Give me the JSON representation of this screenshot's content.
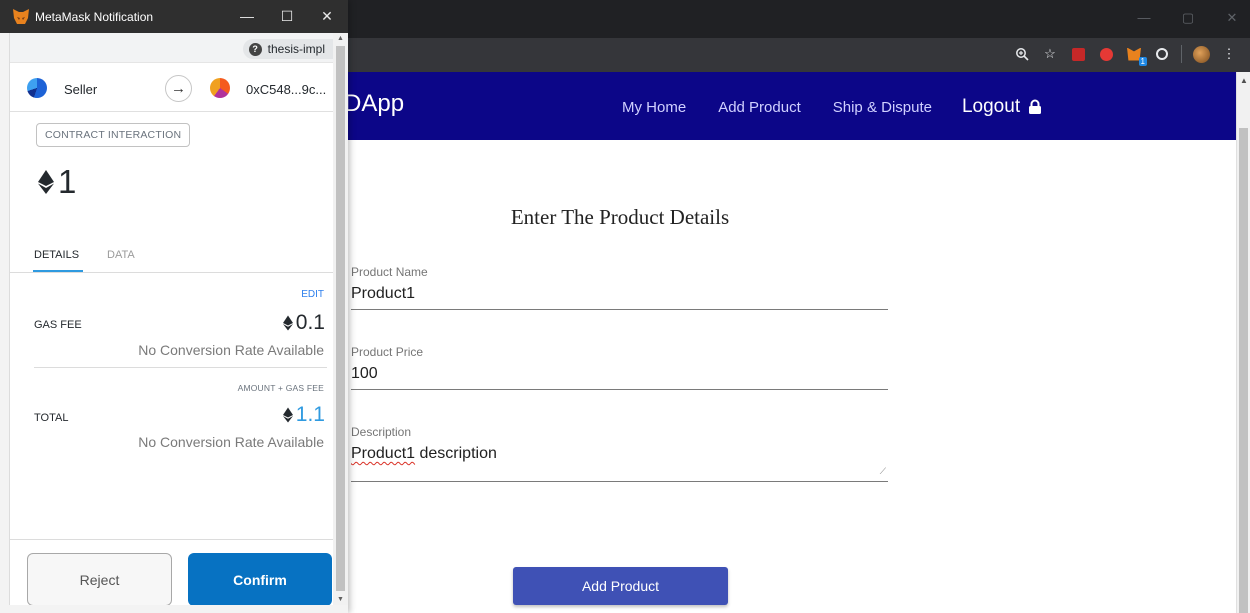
{
  "browser": {
    "window_controls": [
      "—",
      "▢",
      "✕"
    ],
    "toolbar_icons": [
      "zoom-icon",
      "bookmark-star-icon",
      "pdf-extension-icon",
      "adblock-extension-icon",
      "metamask-extension-icon",
      "extension-icon",
      "profile-avatar",
      "menu-icon"
    ],
    "metamask_badge": "1"
  },
  "page": {
    "brand": "DApp",
    "nav": {
      "home": "My Home",
      "add_product": "Add Product",
      "ship_dispute": "Ship & Dispute",
      "logout": "Logout"
    },
    "nav_color": "#0c0688",
    "form": {
      "title": "Enter The Product Details",
      "product_name_label": "Product Name",
      "product_name_value": "Product1",
      "product_price_label": "Product Price",
      "product_price_value": "100",
      "description_label": "Description",
      "description_value_word1": "Product1",
      "description_value_rest": " description",
      "submit_label": "Add Product",
      "submit_color": "#3f51b5"
    }
  },
  "metamask": {
    "window_title": "MetaMask Notification",
    "window_controls": [
      "—",
      "☐",
      "✕"
    ],
    "origin": "thesis-impl",
    "from_account": "Seller",
    "to_address": "0xC548...9c...",
    "action_label": "CONTRACT INTERACTION",
    "amount": "1",
    "tabs": {
      "details": "DETAILS",
      "data": "DATA"
    },
    "edit_label": "EDIT",
    "gas_fee_label": "GAS FEE",
    "gas_fee_eth": "0.1",
    "gas_fee_conversion": "No Conversion Rate Available",
    "amount_gas_label": "AMOUNT + GAS FEE",
    "total_label": "TOTAL",
    "total_eth": "1.1",
    "total_conversion": "No Conversion Rate Available",
    "reject_label": "Reject",
    "confirm_label": "Confirm",
    "confirm_color": "#0772c2",
    "accent_color": "#2f9ae0"
  }
}
